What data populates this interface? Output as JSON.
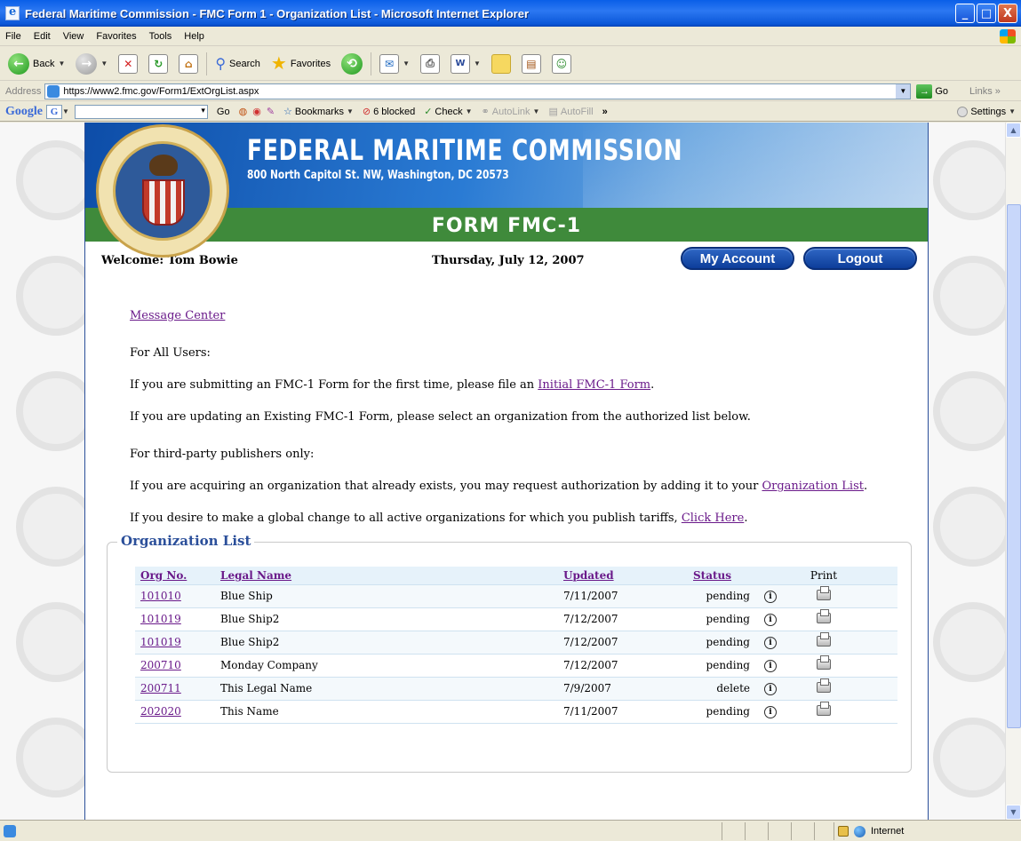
{
  "window": {
    "title": "Federal Maritime Commission - FMC Form 1 - Organization List - Microsoft Internet Explorer",
    "minimize": "_",
    "maximize": "□",
    "close": "X"
  },
  "menu": [
    "File",
    "Edit",
    "View",
    "Favorites",
    "Tools",
    "Help"
  ],
  "toolbar": {
    "back": "Back",
    "search": "Search",
    "favorites": "Favorites"
  },
  "address": {
    "label": "Address",
    "url": "https://www2.fmc.gov/Form1/ExtOrgList.aspx",
    "go": "Go",
    "links": "Links"
  },
  "google_bar": {
    "logo": "Google",
    "box": "G",
    "go": "Go",
    "bookmarks": "Bookmarks",
    "blocked": "6 blocked",
    "check": "Check",
    "autolink": "AutoLink",
    "autofill": "AutoFill",
    "more": "»",
    "settings": "Settings"
  },
  "header": {
    "agency": "FEDERAL MARITIME COMMISSION",
    "address": "800 North Capitol St. NW, Washington, DC 20573",
    "form_title": "FORM FMC-1"
  },
  "userbar": {
    "welcome": "Welcome: Tom Bowie",
    "date": "Thursday, July 12, 2007",
    "my_account": "My Account",
    "logout": "Logout"
  },
  "content": {
    "message_center": "Message Center",
    "all_users": "For All Users:",
    "first_time_pre": "If you are submitting an FMC-1 Form for the first time, please file an ",
    "first_time_link": "Initial FMC-1 Form",
    "first_time_post": ".",
    "updating": "If you are updating an Existing FMC-1 Form, please select an organization from the authorized list below.",
    "third_party": "For third-party publishers only:",
    "acquire_pre": "If you are acquiring an organization that already exists, you may request authorization by adding it to your ",
    "acquire_link": "Organization List",
    "acquire_post": ".",
    "global_pre": "If you desire to make a global change to all active organizations for which you publish tariffs, ",
    "global_link": "Click Here",
    "global_post": "."
  },
  "org_list": {
    "legend": "Organization List",
    "columns": {
      "org_no": "Org No.",
      "legal_name": "Legal Name",
      "updated": "Updated",
      "status": "Status",
      "print": "Print"
    },
    "info_glyph": "i",
    "rows": [
      {
        "org_no": "101010",
        "legal_name": "Blue Ship",
        "updated": "7/11/2007",
        "status": "pending"
      },
      {
        "org_no": "101019",
        "legal_name": "Blue Ship2",
        "updated": "7/12/2007",
        "status": "pending"
      },
      {
        "org_no": "101019",
        "legal_name": "Blue Ship2",
        "updated": "7/12/2007",
        "status": "pending"
      },
      {
        "org_no": "200710",
        "legal_name": "Monday Company",
        "updated": "7/12/2007",
        "status": "pending"
      },
      {
        "org_no": "200711",
        "legal_name": "This Legal Name",
        "updated": "7/9/2007",
        "status": "delete"
      },
      {
        "org_no": "202020",
        "legal_name": "This Name",
        "updated": "7/11/2007",
        "status": "pending"
      }
    ]
  },
  "statusbar": {
    "zone": "Internet"
  }
}
